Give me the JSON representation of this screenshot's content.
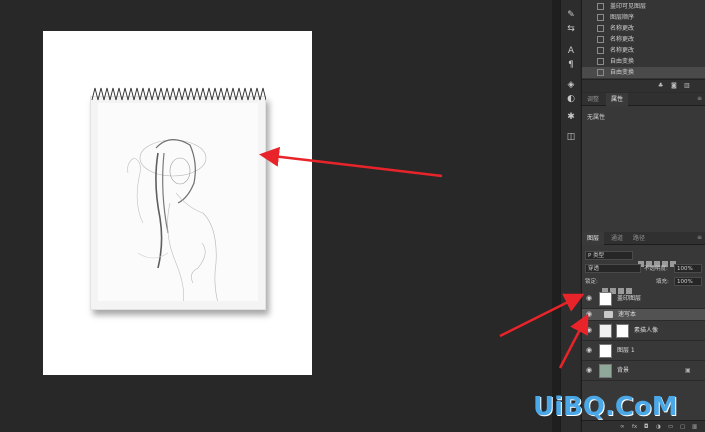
{
  "history": {
    "items": [
      {
        "label": "盖印可见图层"
      },
      {
        "label": "图层顺序"
      },
      {
        "label": "名称更改"
      },
      {
        "label": "名称更改"
      },
      {
        "label": "名称更改"
      },
      {
        "label": "自由变换"
      },
      {
        "label": "自由变换",
        "active": true
      }
    ]
  },
  "props_panel": {
    "tabs": [
      {
        "label": "调整"
      },
      {
        "label": "属性",
        "active": true
      }
    ],
    "empty_text": "无属性"
  },
  "layers_panel": {
    "tabs": [
      {
        "label": "图层",
        "active": true
      },
      {
        "label": "通道"
      },
      {
        "label": "路径"
      }
    ],
    "filter_kind": "P 类型",
    "blend_mode": "穿透",
    "opacity_label": "不透明度:",
    "opacity_value": "100%",
    "lock_label": "锁定:",
    "fill_label": "填充:",
    "fill_value": "100%",
    "layers": [
      {
        "name": "盖印图层",
        "type": "pixel",
        "selected": false
      },
      {
        "name": "速写本",
        "type": "group",
        "selected": true
      },
      {
        "name": "素描人像",
        "type": "smart",
        "selected": false
      },
      {
        "name": "图层 1",
        "type": "pixel",
        "selected": false
      },
      {
        "name": "背景",
        "type": "background",
        "selected": false
      }
    ]
  },
  "watermark": "UiBQ.CoM",
  "colors": {
    "arrow": "#e8242a",
    "watermark": "#4aa8e8"
  }
}
